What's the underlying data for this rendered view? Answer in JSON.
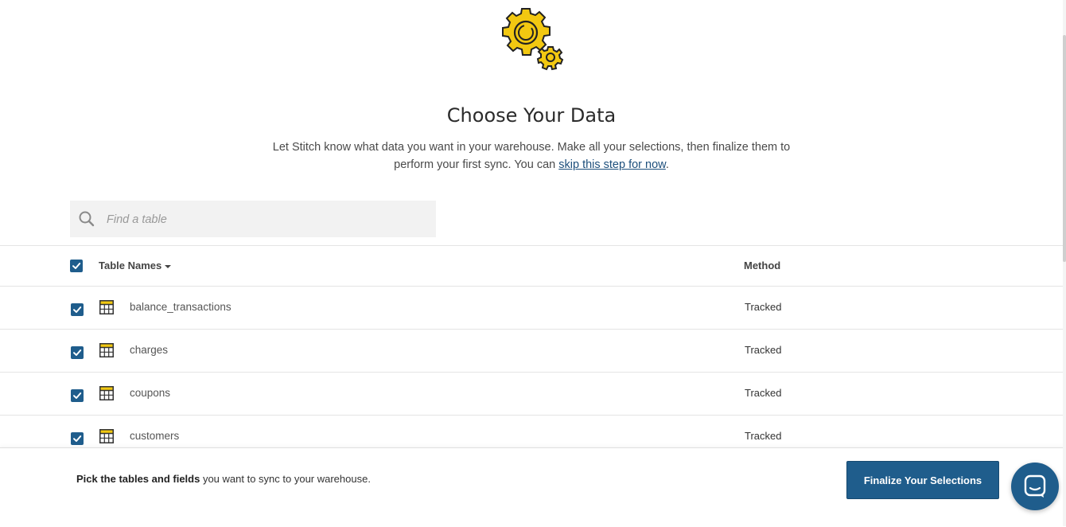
{
  "header": {
    "icon": "gears-icon",
    "title": "Choose Your Data",
    "subtitle_before": "Let Stitch know what data you want in your warehouse. Make all your selections, then finalize them to perform your first sync. You can ",
    "skip_link": "skip this step for now",
    "subtitle_after": "."
  },
  "search": {
    "placeholder": "Find a table",
    "value": "",
    "icon": "search-icon"
  },
  "table": {
    "select_all_checked": true,
    "columns": {
      "names": "Table Names",
      "method": "Method"
    },
    "rows": [
      {
        "name": "balance_transactions",
        "method": "Tracked",
        "checked": true,
        "icon": "table-icon"
      },
      {
        "name": "charges",
        "method": "Tracked",
        "checked": true,
        "icon": "table-icon"
      },
      {
        "name": "coupons",
        "method": "Tracked",
        "checked": true,
        "icon": "table-icon"
      },
      {
        "name": "customers",
        "method": "Tracked",
        "checked": true,
        "icon": "table-icon"
      }
    ]
  },
  "footer": {
    "message_bold": "Pick the tables and fields",
    "message_rest": " you want to sync to your warehouse.",
    "finalize_label": "Finalize Your Selections"
  },
  "chat": {
    "icon": "chat-icon"
  },
  "colors": {
    "accent": "#1f5d8c",
    "gear": "#f2c811",
    "link": "#1d4f7c"
  }
}
